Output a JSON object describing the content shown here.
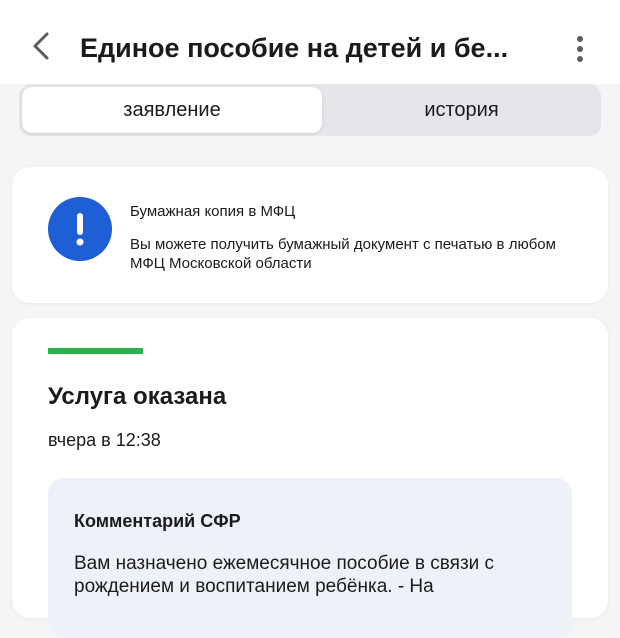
{
  "header": {
    "title": "Единое пособие на детей и бе..."
  },
  "tabs": [
    {
      "label": "заявление",
      "active": true
    },
    {
      "label": "история",
      "active": false
    }
  ],
  "notice": {
    "title": "Бумажная копия в МФЦ",
    "text": "Вы можете получить бумажный документ с печатью в любом МФЦ Московской области",
    "icon": "exclamation-icon",
    "icon_color": "#1f5fd6"
  },
  "status": {
    "title": "Услуга оказана",
    "time": "вчера в 12:38",
    "bar_color": "#2bb24c"
  },
  "comment": {
    "title": "Комментарий СФР",
    "text": "Вам назначено ежемесячное пособие в связи с рождением и воспитанием ребёнка. - На"
  },
  "icons": {
    "back": "chevron-left-icon",
    "menu": "more-vertical-icon"
  }
}
